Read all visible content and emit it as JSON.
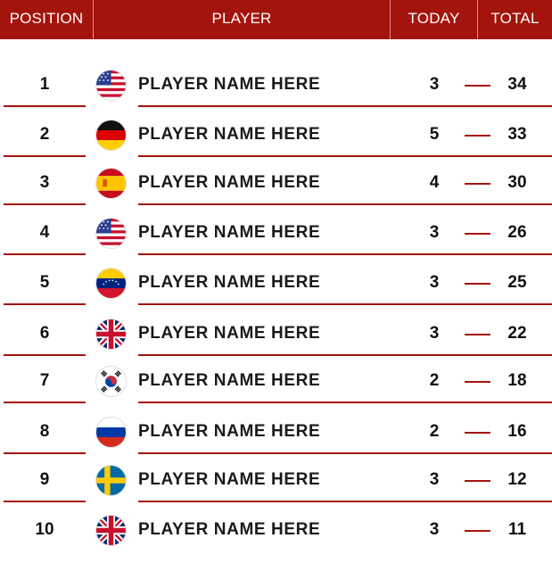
{
  "header": {
    "position": "POSITION",
    "player": "PLAYER",
    "today": "TODAY",
    "total": "TOTAL"
  },
  "colors": {
    "accent": "#a3140c",
    "text": "#1a1a1a",
    "background": "#ffffff"
  },
  "rows": [
    {
      "position": "1",
      "flag": "usa-flag-icon",
      "name": "PLAYER NAME HERE",
      "today": "3",
      "total": "34"
    },
    {
      "position": "2",
      "flag": "germany-flag-icon",
      "name": "PLAYER NAME HERE",
      "today": "5",
      "total": "33"
    },
    {
      "position": "3",
      "flag": "spain-flag-icon",
      "name": "PLAYER NAME HERE",
      "today": "4",
      "total": "30"
    },
    {
      "position": "4",
      "flag": "usa-flag-icon",
      "name": "PLAYER NAME HERE",
      "today": "3",
      "total": "26"
    },
    {
      "position": "5",
      "flag": "venezuela-flag-icon",
      "name": "PLAYER NAME HERE",
      "today": "3",
      "total": "25"
    },
    {
      "position": "6",
      "flag": "uk-flag-icon",
      "name": "PLAYER NAME HERE",
      "today": "3",
      "total": "22"
    },
    {
      "position": "7",
      "flag": "south-korea-flag-icon",
      "name": "PLAYER NAME HERE",
      "today": "2",
      "total": "18"
    },
    {
      "position": "8",
      "flag": "russia-flag-icon",
      "name": "PLAYER NAME HERE",
      "today": "2",
      "total": "16"
    },
    {
      "position": "9",
      "flag": "sweden-flag-icon",
      "name": "PLAYER NAME HERE",
      "today": "3",
      "total": "12"
    },
    {
      "position": "10",
      "flag": "uk-flag-icon",
      "name": "PLAYER NAME HERE",
      "today": "3",
      "total": "11"
    }
  ]
}
